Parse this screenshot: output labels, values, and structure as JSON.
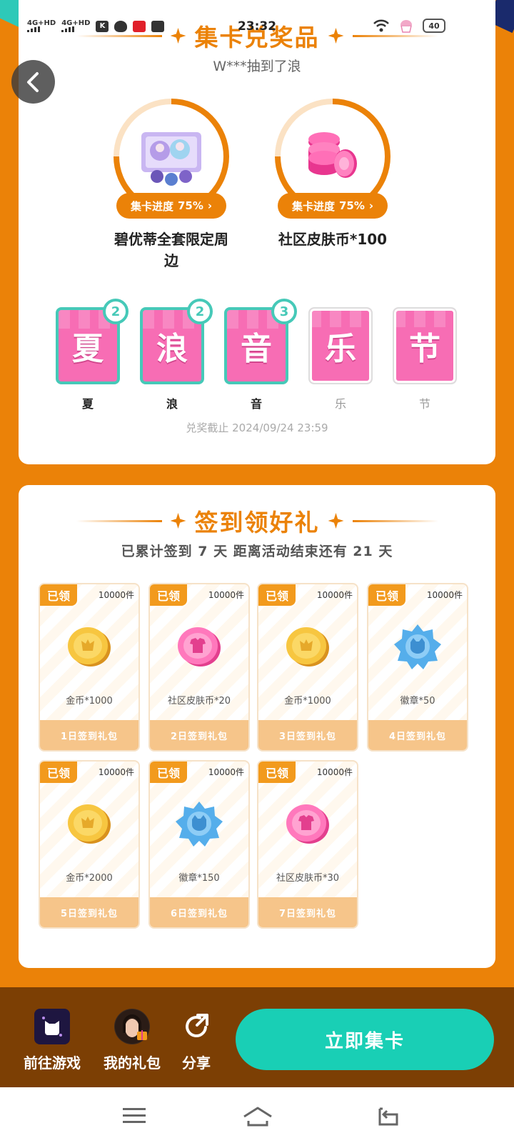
{
  "status_bar": {
    "time": "23:32",
    "signal_1": "4G+HD",
    "signal_2": "4G+HD",
    "battery": "40"
  },
  "prizes": {
    "title": "集卡兑奖品",
    "subtitle": "W***抽到了浪",
    "items": [
      {
        "name": "碧优蒂全套限定周边",
        "progress_label": "集卡进度",
        "progress": "75%",
        "progress_value": 0.75
      },
      {
        "name": "社区皮肤币*100",
        "progress_label": "集卡进度",
        "progress": "75%",
        "progress_value": 0.75
      }
    ],
    "cards": [
      {
        "char": "夏",
        "label": "夏",
        "count": "2",
        "owned": true
      },
      {
        "char": "浪",
        "label": "浪",
        "count": "2",
        "owned": true
      },
      {
        "char": "音",
        "label": "音",
        "count": "3",
        "owned": true
      },
      {
        "char": "乐",
        "label": "乐",
        "count": "",
        "owned": false
      },
      {
        "char": "节",
        "label": "节",
        "count": "",
        "owned": false
      }
    ],
    "deadline": "兑奖截止 2024/09/24 23:59"
  },
  "signin": {
    "title": "签到领好礼",
    "summary": "已累计签到 7 天   距离活动结束还有 21 天",
    "gifts": [
      {
        "tag": "已领",
        "stock": "10000件",
        "reward": "金币*1000",
        "day": "1日签到礼包",
        "icon": "gold-coin"
      },
      {
        "tag": "已领",
        "stock": "10000件",
        "reward": "社区皮肤币*20",
        "day": "2日签到礼包",
        "icon": "skin-coin"
      },
      {
        "tag": "已领",
        "stock": "10000件",
        "reward": "金币*1000",
        "day": "3日签到礼包",
        "icon": "gold-coin"
      },
      {
        "tag": "已领",
        "stock": "10000件",
        "reward": "徽章*50",
        "day": "4日签到礼包",
        "icon": "badge"
      },
      {
        "tag": "已领",
        "stock": "10000件",
        "reward": "金币*2000",
        "day": "5日签到礼包",
        "icon": "gold-coin"
      },
      {
        "tag": "已领",
        "stock": "10000件",
        "reward": "徽章*150",
        "day": "6日签到礼包",
        "icon": "badge"
      },
      {
        "tag": "已领",
        "stock": "10000件",
        "reward": "社区皮肤币*30",
        "day": "7日签到礼包",
        "icon": "skin-coin"
      }
    ]
  },
  "bottom_bar": {
    "go_game": "前往游戏",
    "my_gifts": "我的礼包",
    "share": "分享",
    "collect": "立即集卡"
  },
  "colors": {
    "background": "#EB8208",
    "accent": "#EB8208",
    "teal": "#19CFB5",
    "card_pink": "#F76DB4",
    "bottom_bar": "#7C3F04"
  }
}
